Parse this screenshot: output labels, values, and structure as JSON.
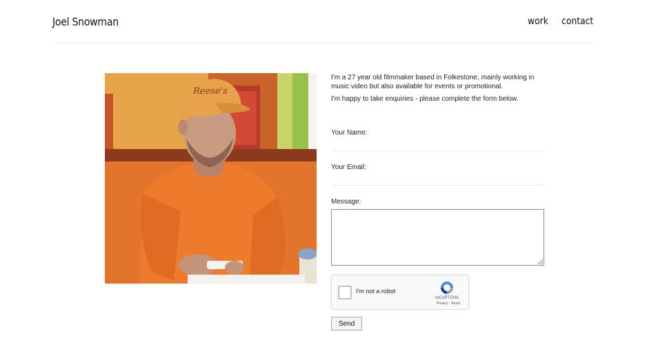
{
  "header": {
    "site_title": "Joel Snowman",
    "nav": [
      {
        "label": "work"
      },
      {
        "label": "contact"
      }
    ]
  },
  "main": {
    "intro": "I'm a 27 year old filmmaker based in Folkestone, mainly working in music video but also available for events or promotional.",
    "enquiry_note": "I'm happy to take enquiries - please complete the form below.",
    "form": {
      "name_label": "Your Name:",
      "name_value": "",
      "email_label": "Your Email:",
      "email_value": "",
      "message_label": "Message:",
      "message_value": "",
      "recaptcha": {
        "checkbox_label": "I'm not a robot",
        "brand": "reCAPTCHA",
        "links": "Privacy - Terms",
        "checked": false
      },
      "send_label": "Send"
    },
    "photo": {
      "cap_text": "Reese's"
    }
  },
  "colors": {
    "background": "#ffffff",
    "text": "#222222",
    "photo_orange": "#e0702a"
  }
}
